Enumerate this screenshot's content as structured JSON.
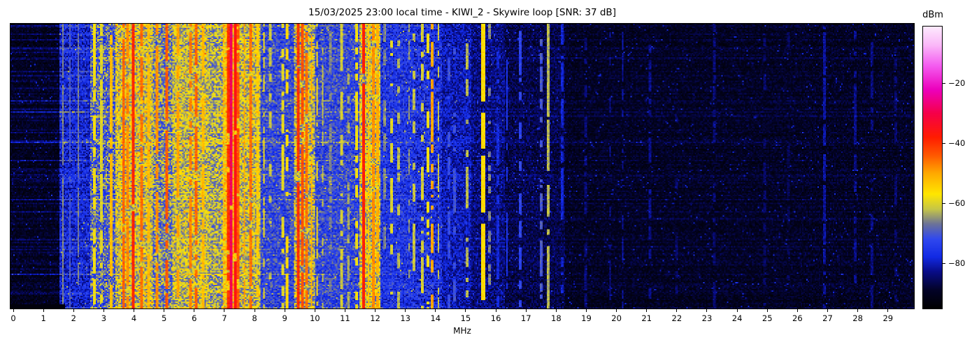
{
  "figure": {
    "datetime_local": "15/03/2025 23:00",
    "station": "KIWI_2",
    "antenna": "Skywire loop",
    "snr_db": 37
  },
  "chart_data": {
    "type": "heatmap",
    "title": "15/03/2025 23:00 local time - KIWI_2 - Skywire loop [SNR: 37 dB]",
    "xlabel": "MHz",
    "ylabel": "",
    "x_range_mhz": [
      0,
      30
    ],
    "x_ticks": [
      "0",
      "1",
      "2",
      "3",
      "4",
      "5",
      "6",
      "7",
      "8",
      "9",
      "10",
      "11",
      "12",
      "13",
      "14",
      "15",
      "16",
      "17",
      "18",
      "19",
      "20",
      "21",
      "22",
      "23",
      "24",
      "25",
      "26",
      "27",
      "28",
      "29"
    ],
    "grid": false,
    "legend": "none",
    "colorbar": {
      "label": "dBm",
      "position": "right",
      "vmin_dbm": -95.3,
      "vmax_dbm": -0.9,
      "ticks": [
        {
          "label": "−20",
          "dbm": -20
        },
        {
          "label": "−40",
          "dbm": -40
        },
        {
          "label": "−60",
          "dbm": -60
        },
        {
          "label": "−80",
          "dbm": -80
        }
      ]
    },
    "colormap_stops": [
      [
        -95.3,
        [
          0,
          0,
          0
        ]
      ],
      [
        -89,
        [
          3,
          3,
          40
        ]
      ],
      [
        -83,
        [
          8,
          12,
          135
        ]
      ],
      [
        -78,
        [
          18,
          42,
          228
        ]
      ],
      [
        -72,
        [
          48,
          72,
          238
        ]
      ],
      [
        -67,
        [
          108,
          114,
          152
        ]
      ],
      [
        -62,
        [
          198,
          198,
          70
        ]
      ],
      [
        -57,
        [
          255,
          230,
          0
        ]
      ],
      [
        -50,
        [
          255,
          168,
          0
        ]
      ],
      [
        -44,
        [
          255,
          88,
          0
        ]
      ],
      [
        -38,
        [
          255,
          28,
          0
        ]
      ],
      [
        -30,
        [
          245,
          0,
          72
        ]
      ],
      [
        -22,
        [
          236,
          0,
          188
        ]
      ],
      [
        -14,
        [
          244,
          92,
          240
        ]
      ],
      [
        -7,
        [
          250,
          185,
          248
        ]
      ],
      [
        -0.9,
        [
          253,
          234,
          253
        ]
      ]
    ],
    "seed": 1337,
    "bands_dbm": [
      [
        -0.2,
        1.5,
        -90.5,
        3.2
      ],
      [
        1.5,
        2.55,
        -79,
        6
      ],
      [
        2.55,
        3.35,
        -70,
        9
      ],
      [
        3.35,
        4.6,
        -61,
        9
      ],
      [
        4.6,
        5.25,
        -67,
        9
      ],
      [
        5.25,
        6.45,
        -62,
        8
      ],
      [
        6.45,
        6.95,
        -64,
        8
      ],
      [
        6.95,
        7.5,
        -56,
        8
      ],
      [
        7.5,
        8.2,
        -62,
        8
      ],
      [
        8.2,
        9.3,
        -73,
        7
      ],
      [
        9.3,
        10.0,
        -63,
        9
      ],
      [
        10.0,
        11.5,
        -73,
        7
      ],
      [
        11.5,
        12.15,
        -61,
        9
      ],
      [
        12.15,
        13.3,
        -76,
        6
      ],
      [
        13.3,
        14.2,
        -77,
        7
      ],
      [
        14.2,
        15.2,
        -81,
        5
      ],
      [
        15.2,
        16.3,
        -84,
        4.5
      ],
      [
        16.3,
        18.3,
        -87,
        4
      ],
      [
        18.3,
        30.2,
        -90,
        3.2
      ]
    ],
    "carriers_dbm": [
      [
        1.63,
        0.03,
        -66,
        0.9
      ],
      [
        1.85,
        0.03,
        -70,
        0.8
      ],
      [
        2.13,
        0.03,
        -67,
        0.85
      ],
      [
        2.65,
        0.05,
        -58,
        0.8
      ],
      [
        2.88,
        0.04,
        -60,
        0.7
      ],
      [
        3.22,
        0.05,
        -52,
        0.85
      ],
      [
        3.64,
        0.05,
        -45,
        0.9
      ],
      [
        3.78,
        0.04,
        -48,
        0.8
      ],
      [
        3.95,
        0.06,
        -39,
        0.95
      ],
      [
        4.24,
        0.04,
        -46,
        0.8
      ],
      [
        4.49,
        0.04,
        -52,
        0.7
      ],
      [
        4.77,
        0.05,
        -48,
        0.8
      ],
      [
        5.06,
        0.05,
        -44,
        0.85
      ],
      [
        5.45,
        0.04,
        -50,
        0.7
      ],
      [
        5.86,
        0.04,
        -47,
        0.75
      ],
      [
        6.07,
        0.05,
        -45,
        0.8
      ],
      [
        6.3,
        0.04,
        -52,
        0.7
      ],
      [
        7.12,
        0.04,
        -40,
        0.9
      ],
      [
        7.21,
        0.07,
        -29,
        0.97
      ],
      [
        7.33,
        0.05,
        -36,
        0.9
      ],
      [
        7.44,
        0.04,
        -44,
        0.8
      ],
      [
        7.65,
        0.04,
        -50,
        0.7
      ],
      [
        7.86,
        0.04,
        -46,
        0.8
      ],
      [
        8.09,
        0.04,
        -54,
        0.6
      ],
      [
        8.3,
        0.04,
        -58,
        0.5
      ],
      [
        8.52,
        0.04,
        -62,
        0.45
      ],
      [
        8.92,
        0.04,
        -59,
        0.5
      ],
      [
        9.05,
        0.04,
        -56,
        0.5
      ],
      [
        9.42,
        0.05,
        -40,
        0.92
      ],
      [
        9.58,
        0.04,
        -43,
        0.85
      ],
      [
        9.72,
        0.05,
        -46,
        0.8
      ],
      [
        9.88,
        0.04,
        -51,
        0.7
      ],
      [
        10.06,
        0.04,
        -56,
        0.6
      ],
      [
        10.25,
        0.04,
        -62,
        0.5
      ],
      [
        10.52,
        0.04,
        -66,
        0.45
      ],
      [
        10.87,
        0.04,
        -61,
        0.5
      ],
      [
        11.1,
        0.04,
        -64,
        0.4
      ],
      [
        11.38,
        0.04,
        -58,
        0.5
      ],
      [
        11.61,
        0.05,
        -38,
        0.97
      ],
      [
        11.78,
        0.04,
        -53,
        0.7
      ],
      [
        11.95,
        0.05,
        -48,
        0.8
      ],
      [
        12.08,
        0.04,
        -51,
        0.7
      ],
      [
        12.3,
        0.04,
        -66,
        0.35
      ],
      [
        12.55,
        0.04,
        -60,
        0.4
      ],
      [
        12.78,
        0.04,
        -63,
        0.4
      ],
      [
        13.12,
        0.04,
        -65,
        0.35
      ],
      [
        13.3,
        0.03,
        -62,
        0.4
      ],
      [
        13.58,
        0.04,
        -61,
        0.45
      ],
      [
        13.75,
        0.04,
        -58,
        0.45
      ],
      [
        13.88,
        0.05,
        -50,
        0.7
      ],
      [
        14.1,
        0.04,
        -62,
        0.4
      ],
      [
        14.45,
        0.04,
        -72,
        0.35
      ],
      [
        14.63,
        0.04,
        -71,
        0.4
      ],
      [
        15.05,
        0.04,
        -63,
        0.5
      ],
      [
        15.58,
        0.05,
        -56,
        0.95
      ],
      [
        15.8,
        0.04,
        -66,
        0.5
      ],
      [
        16.05,
        0.04,
        -78,
        0.4
      ],
      [
        16.37,
        0.04,
        -76,
        0.5
      ],
      [
        16.82,
        0.04,
        -73,
        0.5
      ],
      [
        17.5,
        0.04,
        -70,
        0.55
      ],
      [
        17.73,
        0.05,
        -63,
        0.9
      ],
      [
        18.22,
        0.04,
        -79,
        0.5
      ],
      [
        19.0,
        0.04,
        -84,
        0.4
      ],
      [
        19.8,
        0.04,
        -83,
        0.35
      ],
      [
        20.22,
        0.04,
        -82,
        0.55
      ],
      [
        21.12,
        0.04,
        -83,
        0.5
      ],
      [
        22.0,
        0.04,
        -85,
        0.35
      ],
      [
        23.27,
        0.04,
        -84,
        0.45
      ],
      [
        24.93,
        0.04,
        -85,
        0.4
      ],
      [
        25.7,
        0.04,
        -86,
        0.3
      ],
      [
        26.92,
        0.04,
        -82,
        0.6
      ],
      [
        27.92,
        0.04,
        -83,
        0.5
      ],
      [
        28.5,
        0.04,
        -84,
        0.4
      ],
      [
        29.3,
        0.04,
        -85,
        0.35
      ]
    ]
  }
}
